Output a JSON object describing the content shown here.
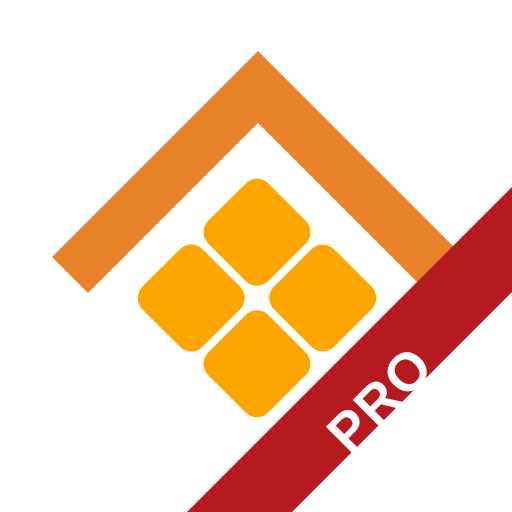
{
  "icon": {
    "name": "tile-grid-pro-app-icon",
    "background_color": "#ffffff",
    "frame_color": "#e8832a",
    "tile_color": "#fda600",
    "ribbon_color": "#b41a1e",
    "ribbon_text_color": "#ffffff"
  },
  "ribbon": {
    "label": "PRO"
  }
}
